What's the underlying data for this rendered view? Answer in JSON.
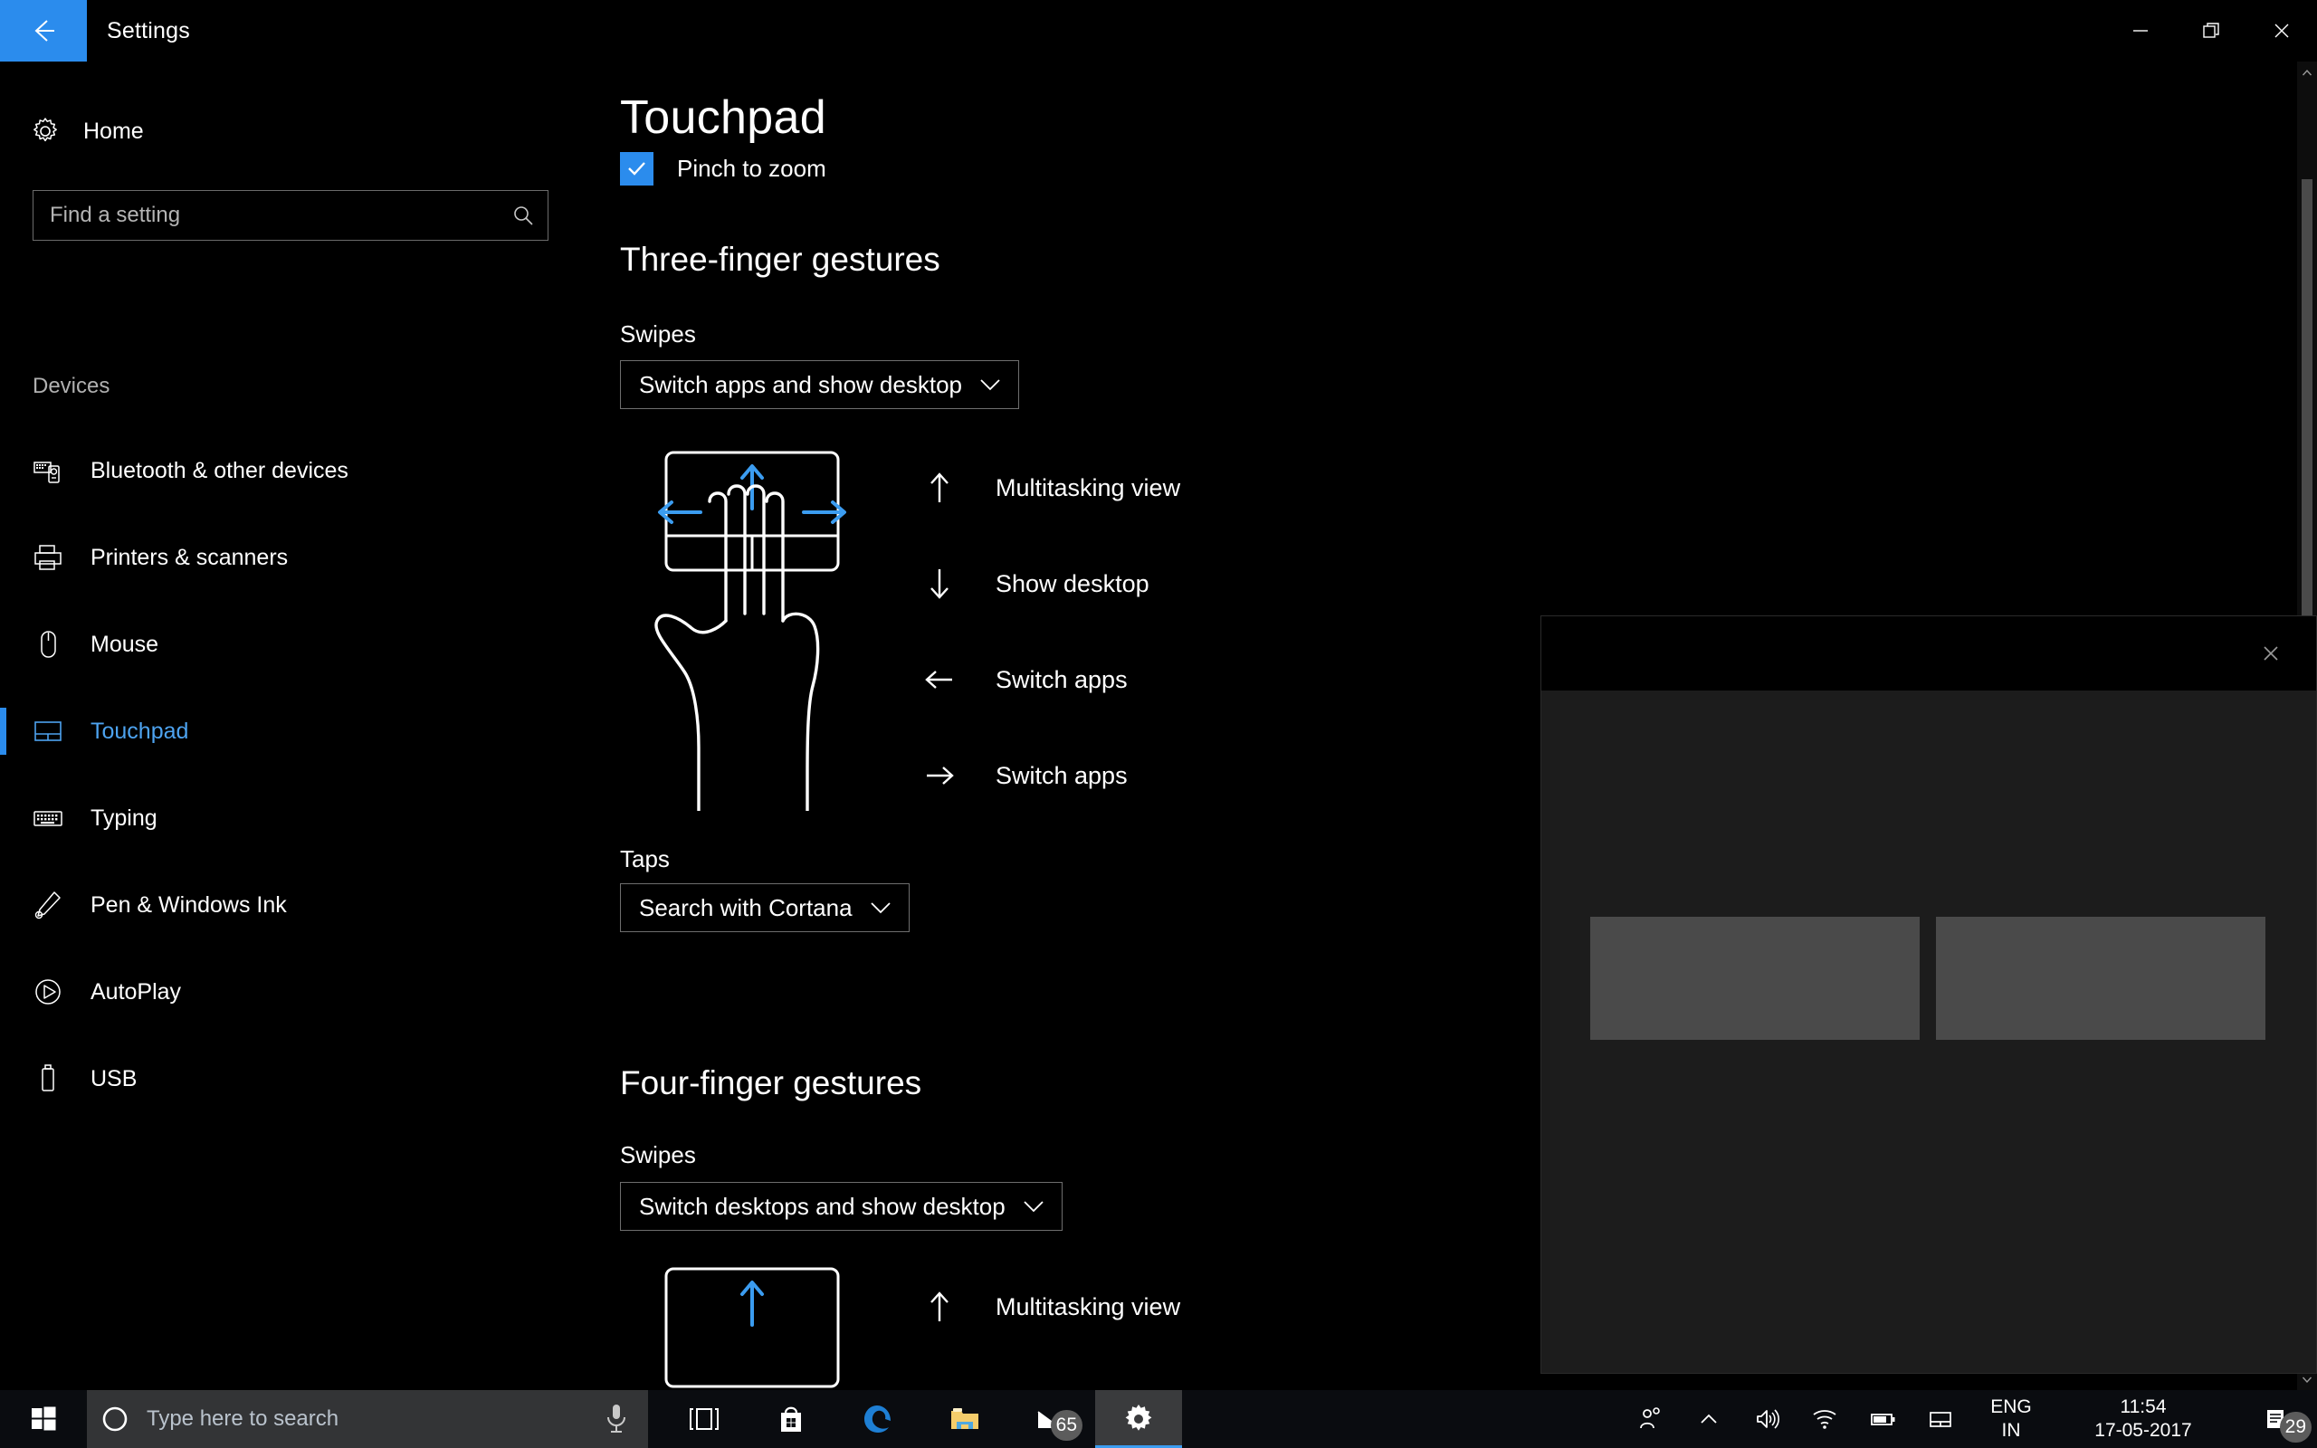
{
  "window": {
    "app_title": "Settings",
    "back_icon": "back-arrow-icon",
    "minimize_label": "–",
    "maximize_label": "❐",
    "close_label": "✕"
  },
  "sidebar": {
    "home_label": "Home",
    "home_icon": "gear-icon",
    "search": {
      "placeholder": "Find a setting",
      "value": "",
      "icon": "search-icon"
    },
    "group_label": "Devices",
    "items": [
      {
        "label": "Bluetooth & other devices",
        "icon": "bluetooth-devices-icon",
        "selected": false
      },
      {
        "label": "Printers & scanners",
        "icon": "printer-icon",
        "selected": false
      },
      {
        "label": "Mouse",
        "icon": "mouse-icon",
        "selected": false
      },
      {
        "label": "Touchpad",
        "icon": "touchpad-icon",
        "selected": true
      },
      {
        "label": "Typing",
        "icon": "keyboard-icon",
        "selected": false
      },
      {
        "label": "Pen & Windows Ink",
        "icon": "pen-icon",
        "selected": false
      },
      {
        "label": "AutoPlay",
        "icon": "autoplay-icon",
        "selected": false
      },
      {
        "label": "USB",
        "icon": "usb-icon",
        "selected": false
      }
    ]
  },
  "main": {
    "page_title": "Touchpad",
    "clipped_setting": {
      "label": "Pinch to zoom",
      "checked": true
    },
    "three_finger": {
      "heading": "Three-finger gestures",
      "swipes_label": "Swipes",
      "swipes_value": "Switch apps and show desktop",
      "taps_label": "Taps",
      "taps_value": "Search with Cortana",
      "legend": [
        {
          "direction": "up",
          "arrow": "↑",
          "label": "Multitasking view"
        },
        {
          "direction": "down",
          "arrow": "↓",
          "label": "Show desktop"
        },
        {
          "direction": "left",
          "arrow": "←",
          "label": "Switch apps"
        },
        {
          "direction": "right",
          "arrow": "→",
          "label": "Switch apps"
        }
      ]
    },
    "four_finger": {
      "heading": "Four-finger gestures",
      "swipes_label": "Swipes",
      "swipes_value": "Switch desktops and show desktop",
      "legend": [
        {
          "direction": "up",
          "arrow": "↑",
          "label": "Multitasking view"
        }
      ]
    }
  },
  "taskbar": {
    "start_icon": "windows-logo-icon",
    "search": {
      "placeholder": "Type here to search",
      "cortana_icon": "cortana-circle-icon",
      "mic_icon": "microphone-icon"
    },
    "buttons": [
      {
        "name": "task-view",
        "icon": "task-view-icon",
        "active": false,
        "badge": ""
      },
      {
        "name": "microsoft-store",
        "icon": "store-bag-icon",
        "active": false,
        "badge": ""
      },
      {
        "name": "microsoft-edge",
        "icon": "edge-icon",
        "active": false,
        "badge": ""
      },
      {
        "name": "file-explorer",
        "icon": "folder-icon",
        "active": false,
        "badge": ""
      },
      {
        "name": "mail",
        "icon": "mail-envelope-icon",
        "active": false,
        "badge": "65"
      },
      {
        "name": "settings",
        "icon": "gear-icon",
        "active": true,
        "badge": ""
      }
    ],
    "tray": {
      "icons": [
        "people-icon",
        "show-hidden-icons-chevron",
        "volume-icon",
        "wifi-icon",
        "battery-icon",
        "touchpad-icon"
      ],
      "language_line1": "ENG",
      "language_line2": "IN",
      "time": "11:54",
      "date": "17-05-2017",
      "notification_icon": "action-center-icon",
      "notification_count": "29"
    }
  },
  "overlay": {
    "close_label": "✕",
    "tiles": [
      "",
      ""
    ]
  },
  "colors": {
    "accent": "#2b8ced",
    "accent_text": "#4da3f0",
    "background": "#000000",
    "taskbar": "#0a0c10",
    "border": "#6e6e6e"
  }
}
